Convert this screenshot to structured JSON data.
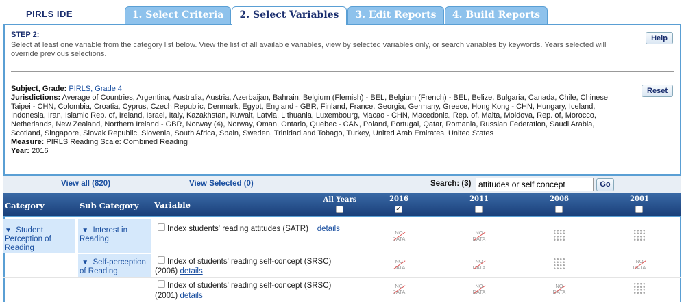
{
  "brand": "PIRLS IDE",
  "tabs": [
    {
      "label": "1. Select Criteria"
    },
    {
      "label": "2. Select Variables"
    },
    {
      "label": "3. Edit Reports"
    },
    {
      "label": "4. Build Reports"
    }
  ],
  "step": {
    "title": "STEP 2:",
    "description": "Select at least one variable from the category list below. View the list of all available variables, view by selected variables only, or search variables by keywords. Years selected will override previous selections."
  },
  "buttons": {
    "help": "Help",
    "reset": "Reset",
    "go": "Go"
  },
  "criteria": {
    "subject_label": "Subject, Grade:",
    "subject_value": "PIRLS, Grade 4",
    "jurisdictions_label": "Jurisdictions:",
    "jurisdictions_value": "Average of Countries, Argentina, Australia, Austria, Azerbaijan, Bahrain, Belgium (Flemish) - BEL, Belgium (French) - BEL, Belize, Bulgaria, Canada, Chile, Chinese Taipei - CHN, Colombia, Croatia, Cyprus, Czech Republic, Denmark, Egypt, England - GBR, Finland, France, Georgia, Germany, Greece, Hong Kong - CHN, Hungary, Iceland, Indonesia, Iran, Islamic Rep. of, Ireland, Israel, Italy, Kazakhstan, Kuwait, Latvia, Lithuania, Luxembourg, Macao - CHN, Macedonia, Rep. of, Malta, Moldova, Rep. of, Morocco, Netherlands, New Zealand, Northern Ireland - GBR, Norway (4), Norway, Oman, Ontario, Quebec - CAN, Poland, Portugal, Qatar, Romania, Russian Federation, Saudi Arabia, Scotland, Singapore, Slovak Republic, Slovenia, South Africa, Spain, Sweden, Trinidad and Tobago, Turkey, United Arab Emirates, United States",
    "measure_label": "Measure:",
    "measure_value": "PIRLS Reading Scale: Combined Reading",
    "year_label": "Year:",
    "year_value": "2016"
  },
  "view": {
    "all": "View all (820)",
    "selected": "View Selected (0)"
  },
  "search": {
    "label": "Search: (3)",
    "value": "attitudes or self concept"
  },
  "columns": {
    "category": "Category",
    "subcategory": "Sub Category",
    "variable": "Variable",
    "all_years": "All Years"
  },
  "years": [
    {
      "label": "2016",
      "checked": true
    },
    {
      "label": "2011",
      "checked": false
    },
    {
      "label": "2006",
      "checked": false
    },
    {
      "label": "2001",
      "checked": false
    }
  ],
  "category": "Student Perception of Reading",
  "subcategories": [
    "Interest in Reading",
    "Self-perception of Reading"
  ],
  "variables": [
    {
      "text": "Index students' reading attitudes (SATR)",
      "link": "details",
      "availability": [
        "nodata",
        "nodata",
        "available",
        "available"
      ]
    },
    {
      "text": "Index of students' reading self-concept (SRSC)",
      "suffix": "(2006)",
      "link": "details",
      "availability": [
        "nodata",
        "nodata",
        "available",
        "nodata"
      ]
    },
    {
      "text": "Index of students' reading self-concept (SRSC)",
      "suffix": "(2001)",
      "link": "details",
      "availability": [
        "nodata",
        "nodata",
        "nodata",
        "available"
      ]
    }
  ],
  "nodata_text": "NO DATA"
}
